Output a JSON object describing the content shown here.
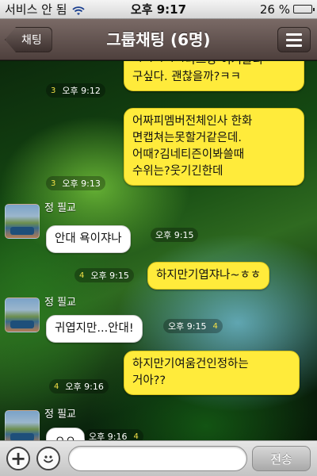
{
  "status_bar": {
    "carrier": "서비스 안 됨",
    "wifi_icon": "wifi-icon",
    "time": "오후 9:17",
    "battery_text": "26 %",
    "battery_level": 0.26
  },
  "navbar": {
    "back_label": "채팅",
    "title": "그룹채팅 (6명)",
    "menu_icon": "menu-icon"
  },
  "messages": [
    {
      "from": "me",
      "lines": [
        "ㅋㅋㅋㅋㅋ나그냥 이거올리",
        "구싶다. 괜찮을까?ㅋㅋ"
      ],
      "unread": "3",
      "time": "오후 9:12"
    },
    {
      "from": "me",
      "lines": [
        "어짜피멤버전체인사 한화",
        "면캡쳐는못할거같은데.",
        "어때?김네티즌이봐쓸때",
        "수위는?웃기긴한데"
      ],
      "unread": "3",
      "time": "오후 9:13"
    },
    {
      "from": "other",
      "sender": "정 필교",
      "text": "안대 욕이쟈나",
      "unread": "",
      "time": "오후 9:15"
    },
    {
      "from": "me",
      "text": "하지만기엽쟈나~ㅎㅎ",
      "unread": "4",
      "time": "오후 9:15"
    },
    {
      "from": "other",
      "sender": "정 필교",
      "text": "귀엽지만...안대!",
      "unread": "4",
      "time": "오후 9:15"
    },
    {
      "from": "me",
      "lines": [
        "하지만기여움건인정하는",
        "거아??"
      ],
      "unread": "4",
      "time": "오후 9:16"
    },
    {
      "from": "other",
      "sender": "정 필교",
      "text": "ㅇㅇ",
      "unread": "4",
      "time": "오후 9:16"
    }
  ],
  "input_bar": {
    "plus_icon": "plus-icon",
    "emoji_icon": "smiley-icon",
    "input_value": "",
    "send_label": "전송"
  }
}
